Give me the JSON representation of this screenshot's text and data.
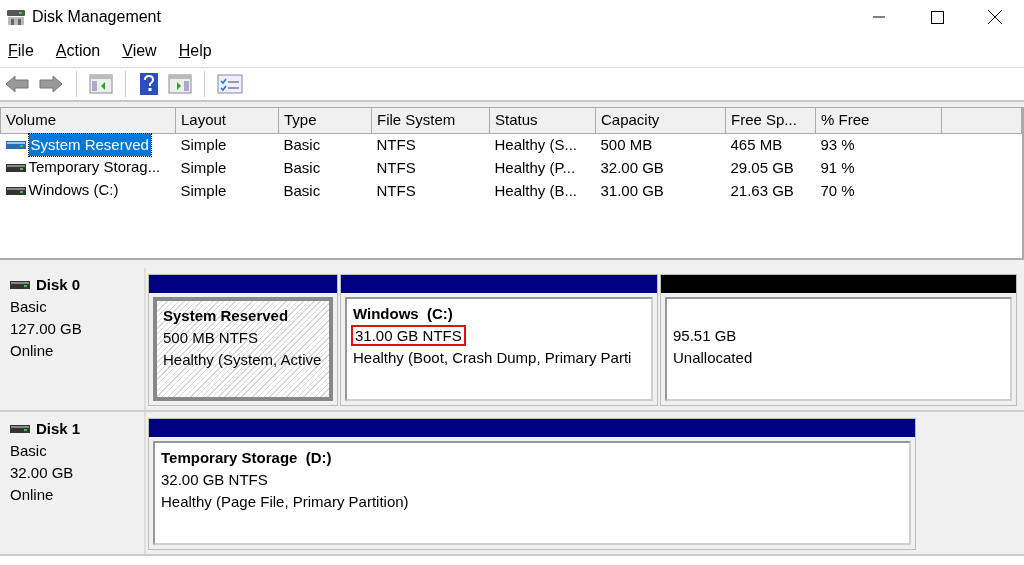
{
  "window": {
    "title": "Disk Management"
  },
  "menu": [
    "File",
    "Action",
    "View",
    "Help"
  ],
  "volume_table": {
    "columns": [
      "Volume",
      "Layout",
      "Type",
      "File System",
      "Status",
      "Capacity",
      "Free Sp...",
      "% Free"
    ],
    "rows": [
      {
        "selected": true,
        "cells": [
          "System Reserved",
          "Simple",
          "Basic",
          "NTFS",
          "Healthy (S...",
          "500 MB",
          "465 MB",
          "93 %"
        ]
      },
      {
        "selected": false,
        "cells": [
          "Temporary Storag...",
          "Simple",
          "Basic",
          "NTFS",
          "Healthy (P...",
          "32.00 GB",
          "29.05 GB",
          "91 %"
        ]
      },
      {
        "selected": false,
        "cells": [
          "Windows (C:)",
          "Simple",
          "Basic",
          "NTFS",
          "Healthy (B...",
          "31.00 GB",
          "21.63 GB",
          "70 %"
        ]
      }
    ]
  },
  "disks": [
    {
      "name": "Disk 0",
      "type": "Basic",
      "size": "127.00 GB",
      "state": "Online",
      "partitions": [
        {
          "kind": "volume",
          "color": "#000080",
          "selected": true,
          "highlighted": false,
          "title": "System Reserved",
          "size": "500 MB NTFS",
          "status": "Healthy (System, Active"
        },
        {
          "kind": "volume",
          "color": "#000080",
          "selected": false,
          "highlighted": true,
          "title": "Windows  (C:)",
          "size": "31.00 GB NTFS",
          "status": "Healthy (Boot, Crash Dump, Primary Parti"
        },
        {
          "kind": "unallocated",
          "color": "#000000",
          "selected": false,
          "highlighted": false,
          "size": "95.51 GB",
          "status": "Unallocated"
        }
      ]
    },
    {
      "name": "Disk 1",
      "type": "Basic",
      "size": "32.00 GB",
      "state": "Online",
      "partitions": [
        {
          "kind": "volume",
          "color": "#000080",
          "selected": false,
          "highlighted": false,
          "title": "Temporary Storage  (D:)",
          "size": "32.00 GB NTFS",
          "status": "Healthy (Page File, Primary Partition)"
        }
      ]
    }
  ]
}
